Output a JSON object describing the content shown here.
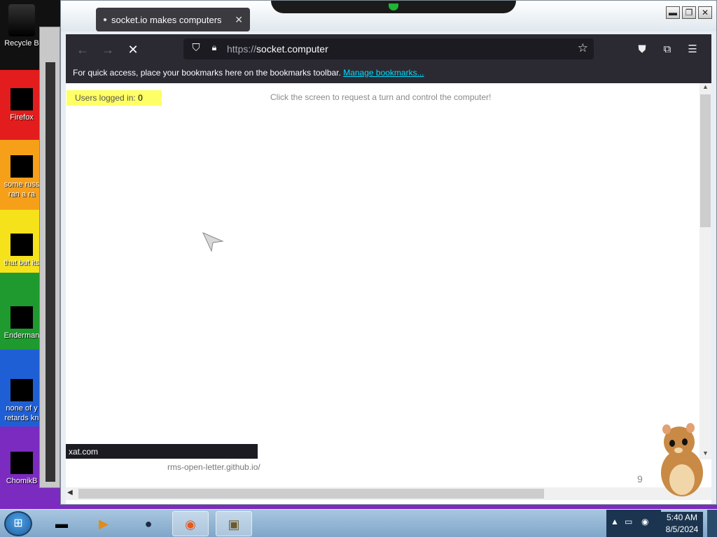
{
  "desktop": {
    "icons": [
      {
        "label": "Recycle B",
        "icon": "recycle-bin-icon"
      },
      {
        "label": "Firefox",
        "icon": "firefox-icon"
      },
      {
        "label": "some russ",
        "label2": "ran a ra",
        "icon": "document-icon"
      },
      {
        "label": "that but its",
        "icon": "folder-icon"
      },
      {
        "label": "Enderman",
        "icon": "app-icon"
      },
      {
        "label": "none of y",
        "label2": "retards kn",
        "icon": "opera-icon"
      },
      {
        "label": "ChomikB",
        "icon": "hamster-icon"
      }
    ]
  },
  "browser": {
    "tab": {
      "title": "socket.io makes computers",
      "close": "✕"
    },
    "url_protocol": "https://",
    "url_host": "socket.computer",
    "bookmarks_bar": {
      "text": "For quick access, place your bookmarks here on the bookmarks toolbar.",
      "link": "Manage bookmarks..."
    },
    "window_controls": {
      "minimize": "▬",
      "restore": "❐",
      "close": "✕"
    }
  },
  "page": {
    "users_label": "Users logged in:",
    "users_count": "0",
    "hint": "Click the screen to request a turn and control the computer!",
    "status_url": "xat.com",
    "below_link": "rms-open-letter.github.io/",
    "counter": "9"
  },
  "taskbar": {
    "time": "5:40 AM",
    "date": "8/5/2024",
    "buttons": [
      "terminal-icon",
      "media-player-icon",
      "globe-icon",
      "firefox-icon",
      "hamster-box-icon"
    ]
  }
}
